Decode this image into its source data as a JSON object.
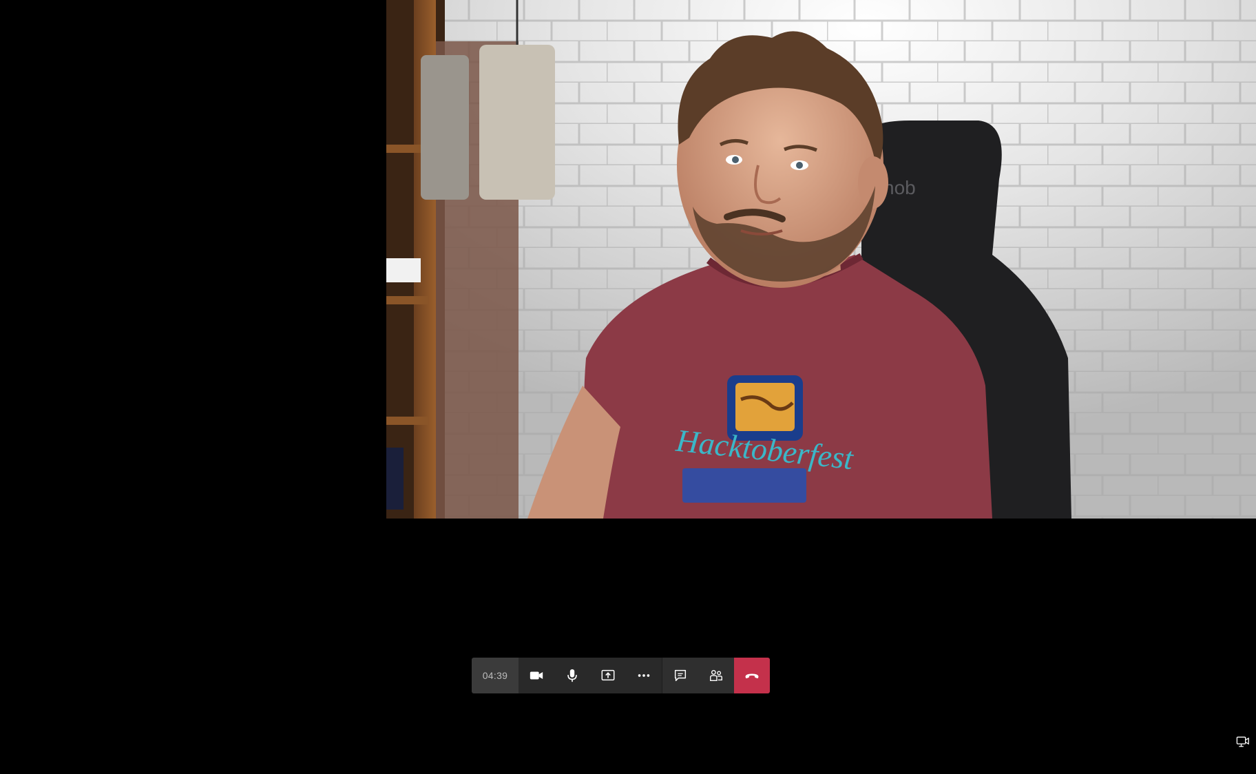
{
  "call": {
    "duration": "04:39"
  },
  "video": {
    "participant_feed": "camera-video",
    "shirt_graphic": "Hacktoberfest",
    "chair_logo": "nob"
  },
  "controls": {
    "camera_icon": "video-camera-icon",
    "mic_icon": "microphone-icon",
    "share_icon": "share-screen-icon",
    "more_icon": "more-actions-icon",
    "chat_icon": "chat-icon",
    "participants_icon": "participants-icon",
    "hangup_icon": "hang-up-icon",
    "hangup_color": "#c4314b",
    "bar_color": "#292929",
    "timer_bg": "#3b3b3b"
  },
  "corner": {
    "icon": "device-settings-icon"
  }
}
